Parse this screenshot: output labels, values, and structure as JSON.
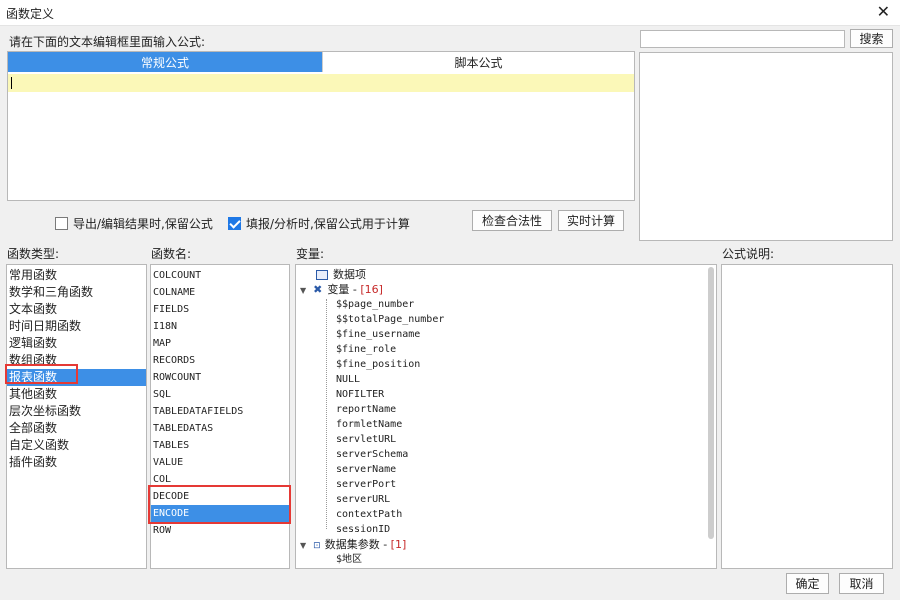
{
  "window": {
    "title": "函数定义"
  },
  "editor": {
    "prompt": "请在下面的文本编辑框里面输入公式:",
    "tabs": [
      {
        "label": "常规公式"
      },
      {
        "label": "脚本公式"
      }
    ],
    "value": ""
  },
  "search": {
    "placeholder": "",
    "button": "搜索"
  },
  "options": {
    "export_keep_formula": {
      "label": "导出/编辑结果时,保留公式",
      "checked": false
    },
    "fill_keep_formula": {
      "label": "填报/分析时,保留公式用于计算",
      "checked": true
    }
  },
  "actions": {
    "check": "检查合法性",
    "realtime": "实时计算"
  },
  "func_types": {
    "header": "函数类型:",
    "items": [
      "常用函数",
      "数学和三角函数",
      "文本函数",
      "时间日期函数",
      "逻辑函数",
      "数组函数",
      "报表函数",
      "其他函数",
      "层次坐标函数",
      "全部函数",
      "自定义函数",
      "插件函数"
    ],
    "selected": "报表函数"
  },
  "func_names": {
    "header": "函数名:",
    "items": [
      "COLCOUNT",
      "COLNAME",
      "FIELDS",
      "I18N",
      "MAP",
      "RECORDS",
      "ROWCOUNT",
      "SQL",
      "TABLEDATAFIELDS",
      "TABLEDATAS",
      "TABLES",
      "VALUE",
      "COL",
      "DECODE",
      "ENCODE",
      "ROW"
    ],
    "selected": "ENCODE"
  },
  "variables": {
    "header": "变量:",
    "data_item": "数据项",
    "var_group": "变量",
    "var_sep": " - ",
    "var_count": "[16]",
    "var_items": [
      "$$page_number",
      "$$totalPage_number",
      "$fine_username",
      "$fine_role",
      "$fine_position",
      "NULL",
      "NOFILTER",
      "reportName",
      "formletName",
      "servletURL",
      "serverSchema",
      "serverName",
      "serverPort",
      "serverURL",
      "contextPath",
      "sessionID"
    ],
    "dataset_group": "数据集参数",
    "dataset_count": "[1]",
    "dataset_items": [
      "$地区"
    ]
  },
  "description": {
    "header": "公式说明:"
  },
  "footer": {
    "ok": "确定",
    "cancel": "取消"
  }
}
